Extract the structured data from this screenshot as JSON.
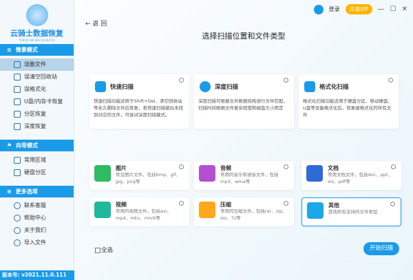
{
  "app": {
    "name": "云骑士数据恢复",
    "subtitle": "YUN QI SHI SHU JU HUI FU",
    "version": "版本号: v2021.11.0.111"
  },
  "sidebar": {
    "sections": [
      {
        "label": "情景模式",
        "items": [
          "误删文件",
          "误清空回收站",
          "误格式化",
          "U盘/内存卡恢复",
          "分区恢复",
          "深度恢复"
        ]
      },
      {
        "label": "向导模式",
        "items": [
          "常用区域",
          "硬盘分区"
        ]
      },
      {
        "label": "更多选项",
        "items": [
          "联系客服",
          "帮助中心",
          "关于我们",
          "导入文件"
        ]
      }
    ],
    "active": "误删文件"
  },
  "header": {
    "login": "登录",
    "vip": "开通VIP",
    "minimize": "—",
    "maximize": "☐",
    "close": "✕",
    "back": "返 回"
  },
  "main": {
    "title": "选择扫描位置和文件类型",
    "scan_modes": [
      {
        "name": "快速扫描",
        "desc": "快速扫描功能适用于Shift+Del、清空回收站等永久删除文件后恢复，若快速扫描貌似未找到对应的文件，可尝试深度扫描模式。"
      },
      {
        "name": "深度扫描",
        "desc": "深度扫描可根据文件数据结构进行文件匹配，扫描时间根据文件复杂程度和磁盘大小而定"
      },
      {
        "name": "格式化扫描",
        "desc": "格式化扫描功能适用于硬盘分区、移动硬盘、U盘等设备格式化后，恢复被格式化的所有文件"
      }
    ],
    "file_types": [
      {
        "name": "图片",
        "desc": "常见图片文件，包括bmp、gif、jpg、png等",
        "color": "#2dbb63"
      },
      {
        "name": "音频",
        "desc": "常用的音乐和语音文件，包括mp3、wma等",
        "color": "#b44fd0"
      },
      {
        "name": "文档",
        "desc": "常用文档文件，包括doc、ppt、xls、pdf等",
        "color": "#2f6bd6"
      },
      {
        "name": "视频",
        "desc": "常用的视频文件，包括avi、mp4、mkv、rmvb等",
        "color": "#1fb89a"
      },
      {
        "name": "压缩",
        "desc": "常用的压缩文件，包括rar、zip、ios、7z等",
        "color": "#ffa81a"
      },
      {
        "name": "其他",
        "desc": "其他所有支持的文件类型",
        "color": "#1aa8ea"
      }
    ],
    "selected": "其他",
    "select_all": "全选",
    "start": "开始扫描"
  }
}
